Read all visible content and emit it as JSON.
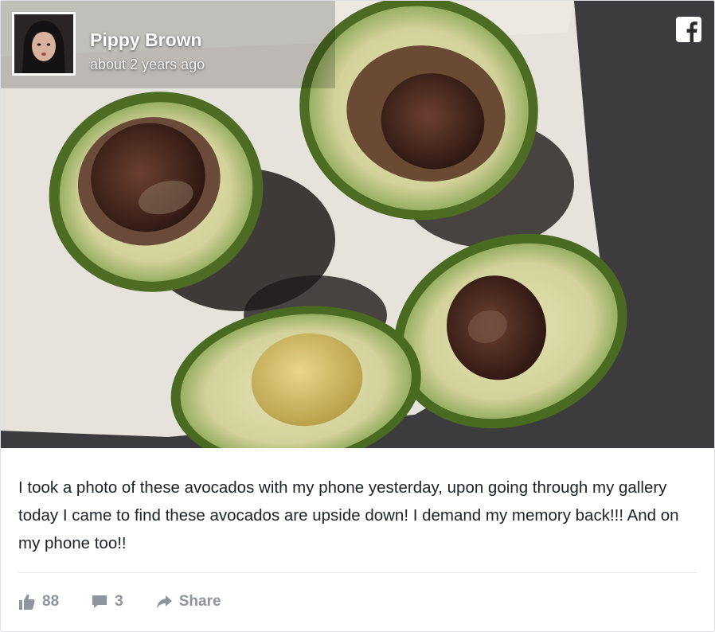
{
  "post": {
    "author": "Pippy Brown",
    "timestamp": "about 2 years ago",
    "text": "I took a photo of these avocados with my phone yesterday, upon going through my gallery today I came to find these avocados are upside down! I demand my memory back!!! And on my phone too!!",
    "likes": "88",
    "comments": "3",
    "share_label": "Share"
  },
  "icons": {
    "brand": "facebook-icon",
    "like": "thumbs-up-icon",
    "comment": "comment-bubble-icon",
    "share": "share-arrow-icon"
  },
  "colors": {
    "action_gray": "#90949c",
    "text": "#1d2129"
  }
}
